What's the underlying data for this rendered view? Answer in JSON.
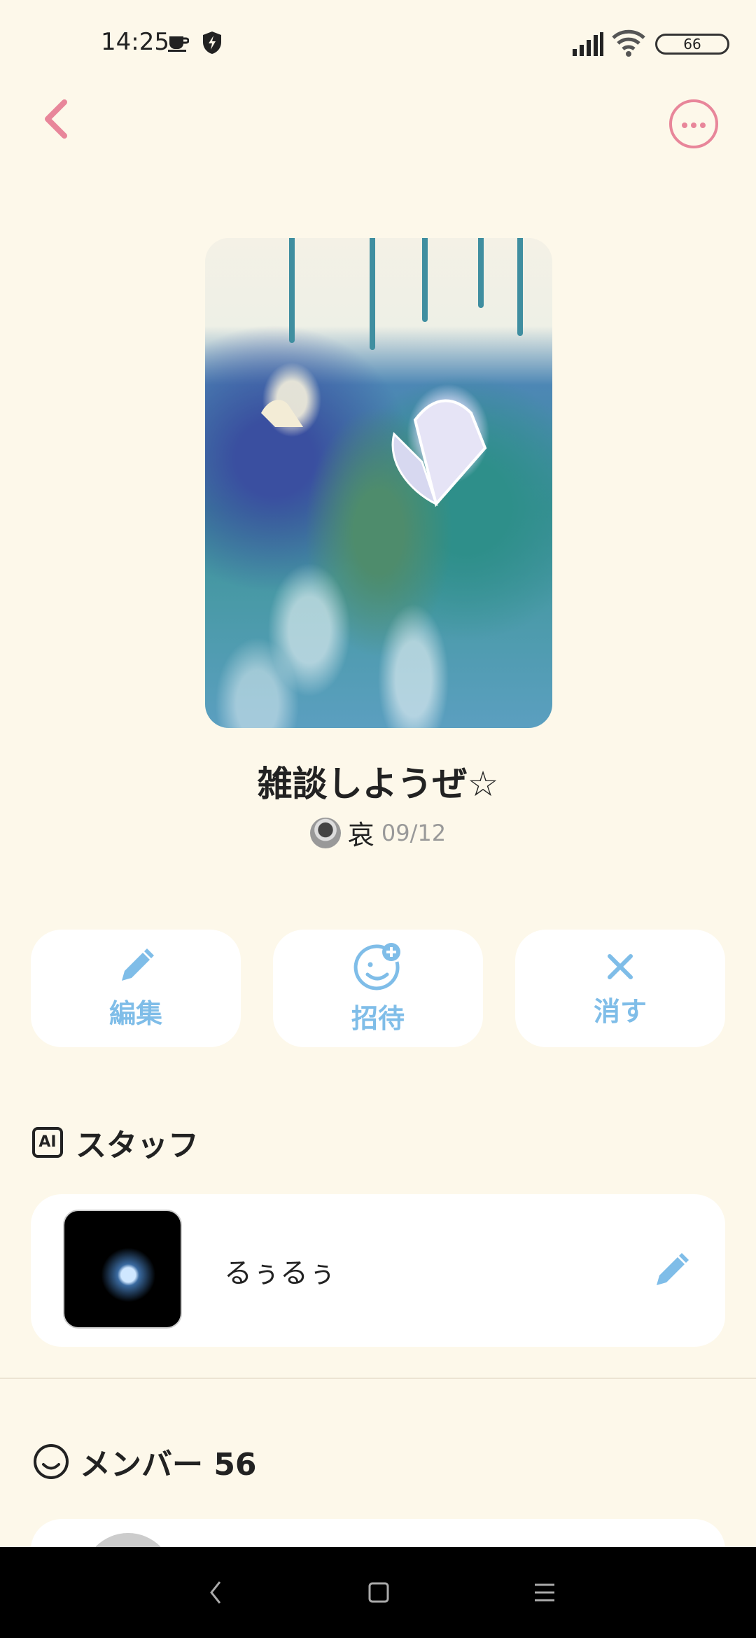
{
  "status_bar": {
    "time": "14:25",
    "battery": "66"
  },
  "group": {
    "title": "雑談しようぜ☆",
    "author": "哀",
    "date": "09/12"
  },
  "actions": [
    {
      "label": "編集",
      "icon": "pencil-icon"
    },
    {
      "label": "招待",
      "icon": "add-smiley-icon"
    },
    {
      "label": "消す",
      "icon": "close-icon"
    }
  ],
  "staff": {
    "section_icon": "AI",
    "title": "スタッフ",
    "name": "るぅるぅ"
  },
  "members": {
    "title": "メンバー 56"
  },
  "colors": {
    "background": "#fdf8ea",
    "accent_pink": "#e8869a",
    "accent_blue": "#7fbde8"
  }
}
